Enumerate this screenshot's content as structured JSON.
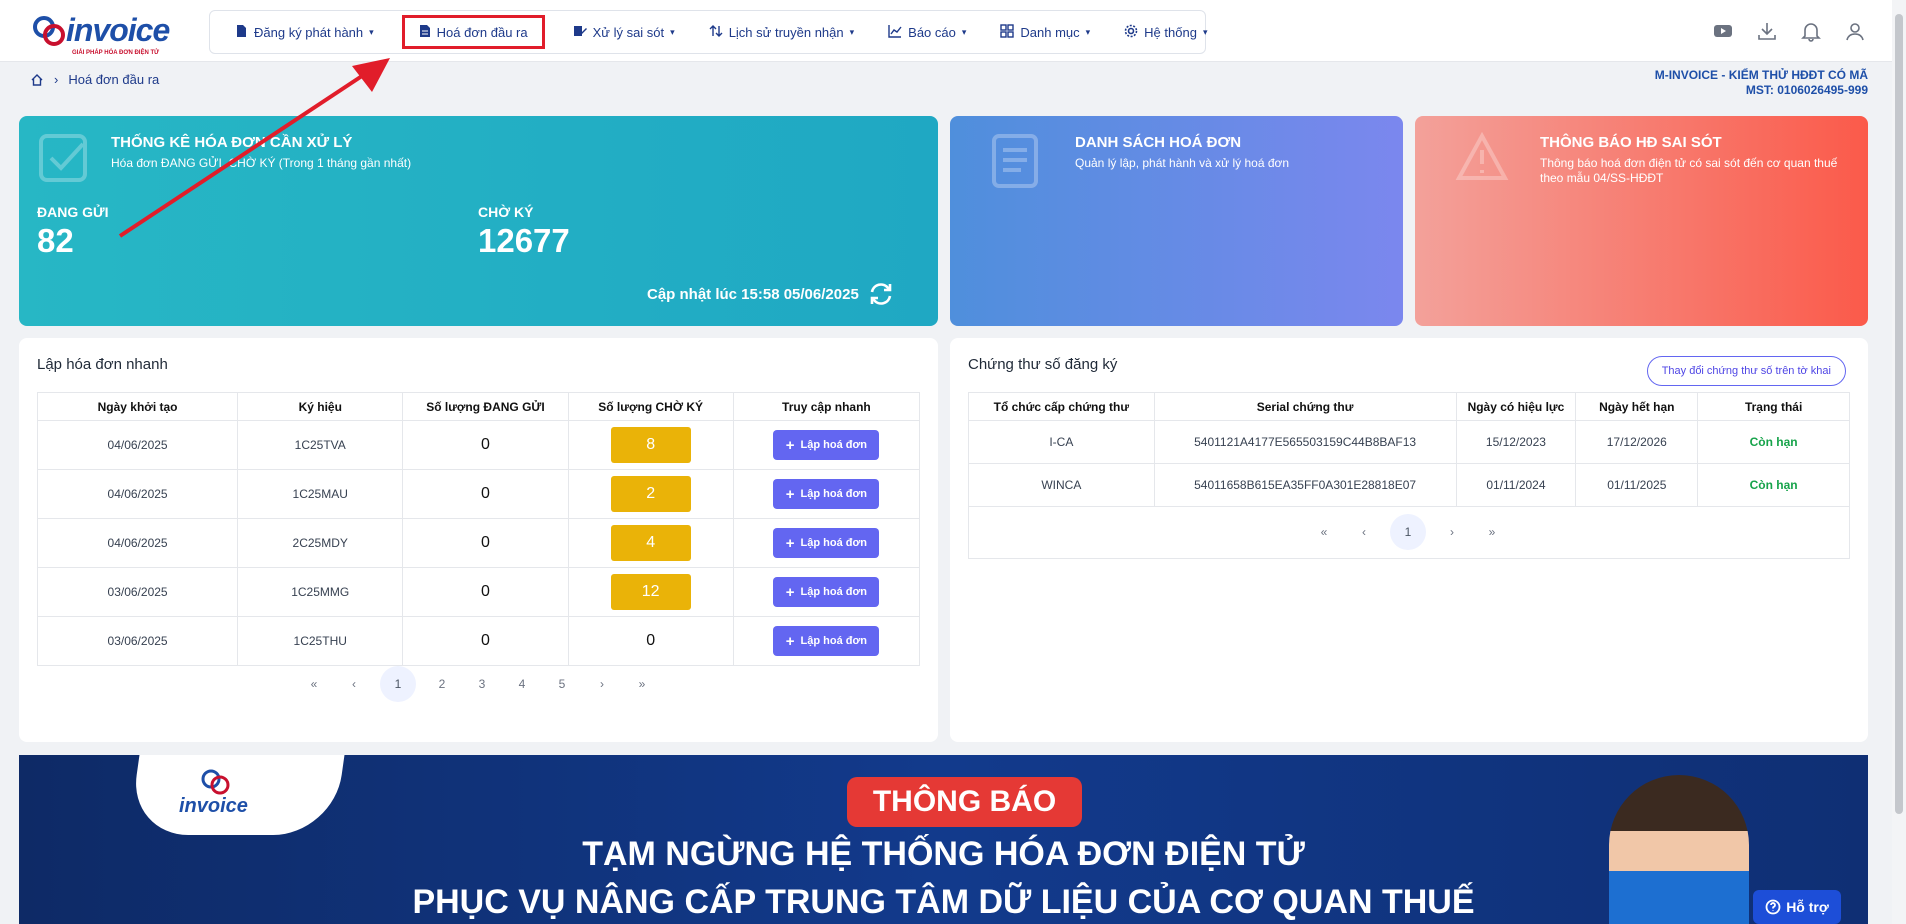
{
  "app": {
    "logo_text": "invoice",
    "logo_sub": "GIẢI PHÁP HÓA ĐƠN ĐIỆN TỬ"
  },
  "nav": [
    {
      "label": "Đăng ký phát hành",
      "icon": "file-icon",
      "chevron": true
    },
    {
      "label": "Hoá đơn đầu ra",
      "icon": "document-icon",
      "chevron": false,
      "active": true
    },
    {
      "label": "Xử lý sai sót",
      "icon": "edit-icon",
      "chevron": true
    },
    {
      "label": "Lịch sử truyền nhận",
      "icon": "transfer-icon",
      "chevron": true
    },
    {
      "label": "Báo cáo",
      "icon": "chart-icon",
      "chevron": true
    },
    {
      "label": "Danh mục",
      "icon": "grid-icon",
      "chevron": true
    },
    {
      "label": "Hệ thống",
      "icon": "gear-icon",
      "chevron": true
    }
  ],
  "breadcrumb": {
    "current": "Hoá đơn đầu ra"
  },
  "org": {
    "name": "M-INVOICE - KIỂM THỬ HĐĐT CÓ MÃ",
    "mst": "MST: 0106026495-999"
  },
  "cards": {
    "stats": {
      "title": "THỐNG KÊ HÓA ĐƠN CẦN XỬ LÝ",
      "subtitle": "Hóa đơn ĐANG GỬI, CHỜ KÝ (Trong 1 tháng gần nhất)",
      "sending_label": "ĐANG GỬI",
      "sending_value": "82",
      "pending_label": "CHỜ KÝ",
      "pending_value": "12677",
      "updated": "Cập nhật lúc 15:58 05/06/2025"
    },
    "invoice_list": {
      "title": "DANH SÁCH HOÁ ĐƠN",
      "subtitle": "Quản lý lập, phát hành và xử lý hoá đơn"
    },
    "error_notice": {
      "title": "THÔNG BÁO HĐ SAI SÓT",
      "subtitle": "Thông báo hoá đơn điện tử có sai sót đến cơ quan thuế theo mẫu 04/SS-HĐĐT"
    }
  },
  "quick": {
    "title": "Lập hóa đơn nhanh",
    "headers": [
      "Ngày khởi tạo",
      "Ký hiệu",
      "Số lượng ĐANG GỬI",
      "Số lượng CHỜ KÝ",
      "Truy cập nhanh"
    ],
    "button_label": "Lập hoá đơn",
    "rows": [
      {
        "date": "04/06/2025",
        "symbol": "1C25TVA",
        "sending": "0",
        "pending": "8",
        "badge": true
      },
      {
        "date": "04/06/2025",
        "symbol": "1C25MAU",
        "sending": "0",
        "pending": "2",
        "badge": true
      },
      {
        "date": "04/06/2025",
        "symbol": "2C25MDY",
        "sending": "0",
        "pending": "4",
        "badge": true
      },
      {
        "date": "03/06/2025",
        "symbol": "1C25MMG",
        "sending": "0",
        "pending": "12",
        "badge": true
      },
      {
        "date": "03/06/2025",
        "symbol": "1C25THU",
        "sending": "0",
        "pending": "0",
        "badge": false
      }
    ],
    "pages": [
      "1",
      "2",
      "3",
      "4",
      "5"
    ]
  },
  "certs": {
    "title": "Chứng thư số đăng ký",
    "change_button": "Thay đổi chứng thư số trên tờ khai",
    "headers": [
      "Tổ chức cấp chứng thư",
      "Serial chứng thư",
      "Ngày có hiệu lực",
      "Ngày hết hạn",
      "Trạng thái"
    ],
    "rows": [
      {
        "issuer": "I-CA",
        "serial": "5401121A4177E565503159C44B8BAF13",
        "from": "15/12/2023",
        "to": "17/12/2026",
        "status": "Còn hạn"
      },
      {
        "issuer": "WINCA",
        "serial": "54011658B615EA35FF0A301E28818E07",
        "from": "01/11/2024",
        "to": "01/11/2025",
        "status": "Còn hạn"
      }
    ],
    "pages": [
      "1"
    ]
  },
  "banner": {
    "logo_text": "invoice",
    "pill": "THÔNG BÁO",
    "line1": "TẠM NGỪNG HỆ THỐNG HÓA ĐƠN ĐIỆN TỬ",
    "line2": "PHỤC VỤ NÂNG CẤP TRUNG TÂM DỮ LIỆU CỦA CƠ QUAN THUẾ"
  },
  "help": {
    "label": "Hỗ trợ"
  },
  "colors": {
    "accent": "#6366f1",
    "badge": "#eab308",
    "ok": "#16a34a",
    "annotation": "#e11d2a"
  }
}
